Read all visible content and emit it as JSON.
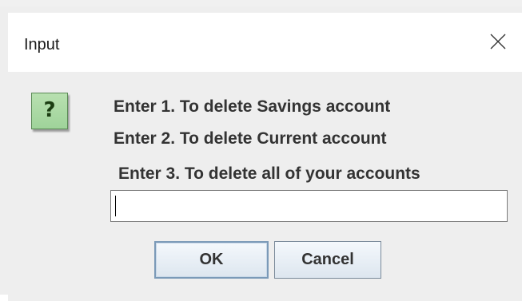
{
  "window": {
    "title": "Input",
    "close_glyph": "✕"
  },
  "dialog": {
    "icon": "question-icon",
    "icon_glyph": "?",
    "messages": [
      "Enter 1. To delete Savings account",
      "Enter 2. To delete Current account",
      "Enter 3. To delete all of your accounts"
    ],
    "input": {
      "value": "",
      "placeholder": ""
    },
    "buttons": {
      "ok_label": "OK",
      "cancel_label": "Cancel"
    }
  },
  "colors": {
    "icon_bg": "#9fd39a",
    "icon_fg": "#1b3d12",
    "dialog_bg": "#eeeeee",
    "text": "#333333"
  }
}
